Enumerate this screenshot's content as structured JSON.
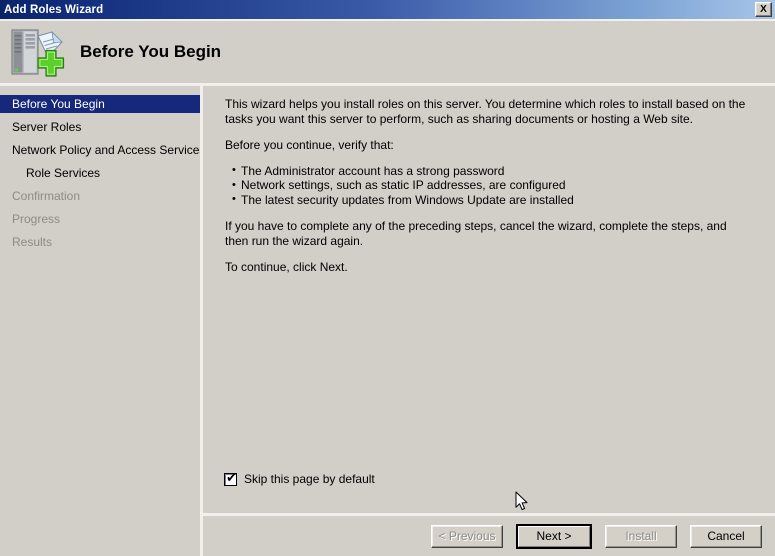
{
  "window": {
    "title": "Add Roles Wizard",
    "close_label": "X"
  },
  "header": {
    "title": "Before You Begin",
    "icon": "server-add-icon"
  },
  "sidebar": {
    "items": [
      {
        "label": "Before You Begin",
        "state": "selected"
      },
      {
        "label": "Server Roles",
        "state": "enabled"
      },
      {
        "label": "Network Policy and Access Services",
        "state": "enabled"
      },
      {
        "label": "Role Services",
        "state": "enabled-indent"
      },
      {
        "label": "Confirmation",
        "state": "disabled"
      },
      {
        "label": "Progress",
        "state": "disabled"
      },
      {
        "label": "Results",
        "state": "disabled"
      }
    ]
  },
  "content": {
    "intro": "This wizard helps you install roles on this server. You determine which roles to install based on the tasks you want this server to perform, such as sharing documents or hosting a Web site.",
    "verify_heading": "Before you continue, verify that:",
    "verify_items": [
      "The Administrator account has a strong password",
      "Network settings, such as static IP addresses, are configured",
      "The latest security updates from Windows Update are installed"
    ],
    "cancel_note": "If you have to complete any of the preceding steps, cancel the wizard, complete the steps, and then run the wizard again.",
    "continue_note": "To continue, click Next."
  },
  "skip_option": {
    "label": "Skip this page by default",
    "checked": true,
    "tick": "✔"
  },
  "buttons": {
    "previous": {
      "label": "< Previous",
      "enabled": false
    },
    "next": {
      "label": "Next >",
      "enabled": true,
      "default": true
    },
    "install": {
      "label": "Install",
      "enabled": false
    },
    "cancel": {
      "label": "Cancel",
      "enabled": true
    }
  },
  "colors": {
    "titlebar_dark": "#0a246a",
    "titlebar_light": "#a8c5e8",
    "window_background": "#d2cec8",
    "selection": "#16287b",
    "disabled_text": "#8e8b86",
    "accent_green": "#4caf1f"
  }
}
